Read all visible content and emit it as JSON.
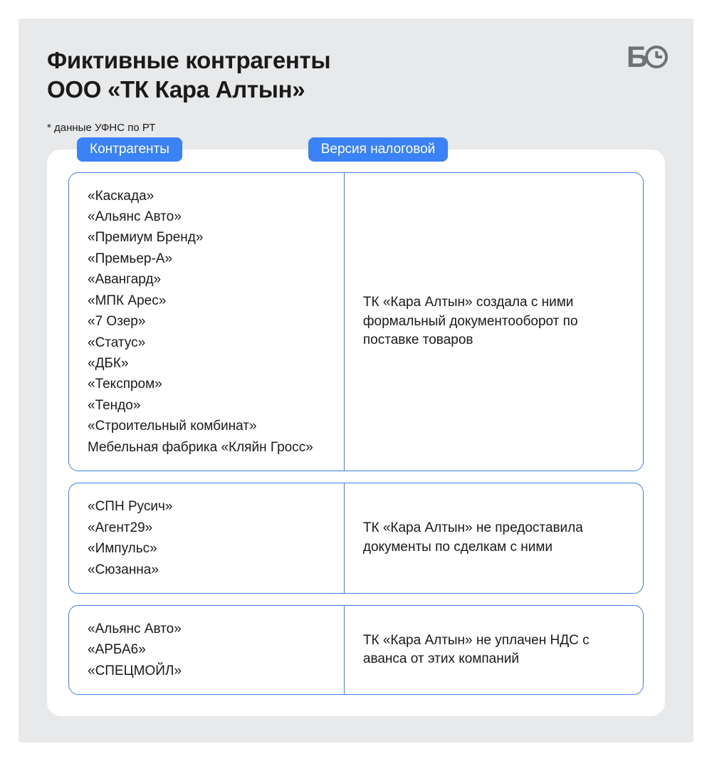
{
  "title_line1": "Фиктивные контрагенты",
  "title_line2": "ООО «ТК Кара Алтын»",
  "subtitle": "* данные УФНС по РТ",
  "logo_letter": "Б",
  "headers": {
    "left": "Контрагенты",
    "right": "Версия налоговой"
  },
  "sections": [
    {
      "companies": [
        "«Каскада»",
        "«Альянс Авто»",
        "«Премиум Бренд»",
        "«Премьер-А»",
        "«Авангард»",
        "«МПК Арес»",
        "«7 Озер»",
        "«Статус»",
        "«ДБК»",
        "«Текспром»",
        "«Тендо»",
        "«Строительный комбинат»",
        "Мебельная фабрика «Кляйн Гросс»"
      ],
      "description": "ТК «Кара Алтын» создала с ними формальный документооборот по поставке товаров"
    },
    {
      "companies": [
        "«СПН Русич»",
        "«Агент29»",
        "«Импульс»",
        "«Сюзанна»"
      ],
      "description": "ТК «Кара Алтын» не предоставила документы по сделкам с ними"
    },
    {
      "companies": [
        "«Альянс Авто»",
        "«АРБА6»",
        "«СПЕЦМОЙЛ»"
      ],
      "description": "ТК «Кара Алтын» не уплачен НДС с аванса от этих компаний"
    }
  ]
}
